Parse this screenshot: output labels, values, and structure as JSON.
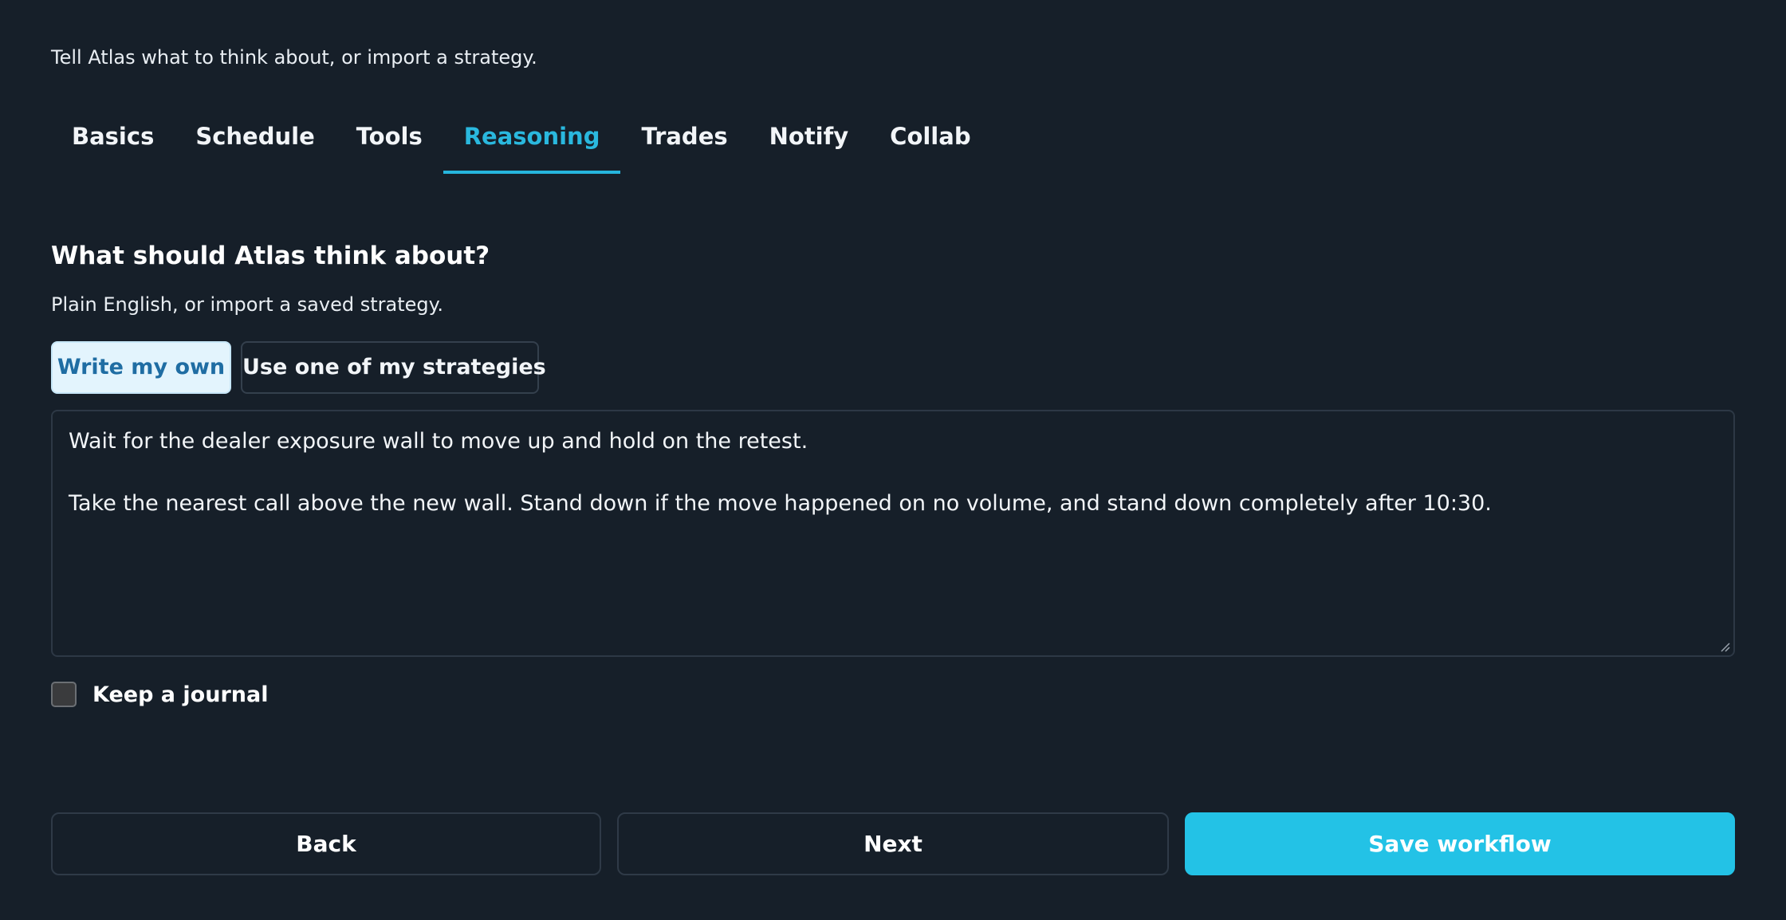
{
  "header": {
    "subtitle": "Tell Atlas what to think about, or import a strategy."
  },
  "tabs": [
    {
      "label": "Basics",
      "active": false
    },
    {
      "label": "Schedule",
      "active": false
    },
    {
      "label": "Tools",
      "active": false
    },
    {
      "label": "Reasoning",
      "active": true
    },
    {
      "label": "Trades",
      "active": false
    },
    {
      "label": "Notify",
      "active": false
    },
    {
      "label": "Collab",
      "active": false
    }
  ],
  "reasoning": {
    "title": "What should Atlas think about?",
    "description": "Plain English, or import a saved strategy.",
    "mode_options": {
      "write_own": "Write my own",
      "use_strategy": "Use one of my strategies",
      "selected": "Write my own"
    },
    "prompt_lines": [
      "Wait for the dealer exposure wall to move up and hold on the retest.",
      "",
      "Take the nearest call above the new wall. Stand down if the move happened on no volume, and stand down completely after 10:30."
    ],
    "journal": {
      "label": "Keep a journal",
      "checked": false
    }
  },
  "footer": {
    "back_label": "Back",
    "next_label": "Next",
    "save_label": "Save workflow"
  },
  "colors": {
    "background": "#161f29",
    "accent": "#23c2e6",
    "active_tab": "#2ab8de",
    "selected_segment_bg": "#e3f4fd",
    "selected_segment_text": "#1f6da3"
  }
}
